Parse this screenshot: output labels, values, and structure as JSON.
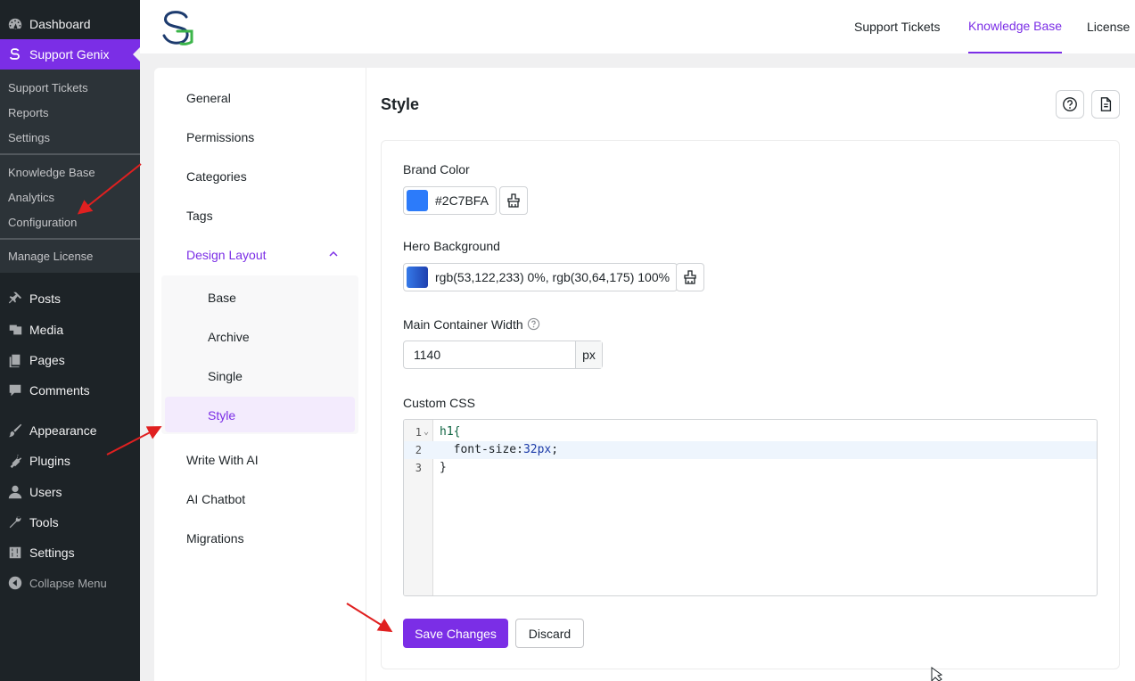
{
  "wp_menu": {
    "dashboard": "Dashboard",
    "support_genix": "Support Genix",
    "submenu_1": [
      "Support Tickets",
      "Reports",
      "Settings"
    ],
    "submenu_2": [
      "Knowledge Base",
      "Analytics",
      "Configuration"
    ],
    "submenu_3": [
      "Manage License"
    ],
    "items": [
      "Posts",
      "Media",
      "Pages",
      "Comments",
      "Appearance",
      "Plugins",
      "Users",
      "Tools",
      "Settings"
    ],
    "collapse": "Collapse Menu"
  },
  "top_tabs": [
    "Support Tickets",
    "Knowledge Base",
    "License"
  ],
  "settings_nav": {
    "items_top": [
      "General",
      "Permissions",
      "Categories",
      "Tags"
    ],
    "design_layout": "Design Layout",
    "design_sub": [
      "Base",
      "Archive",
      "Single",
      "Style"
    ],
    "items_bottom": [
      "Write With AI",
      "AI Chatbot",
      "Migrations"
    ]
  },
  "main": {
    "title": "Style",
    "brand_color_label": "Brand Color",
    "brand_color_value": "#2C7BFA",
    "hero_bg_label": "Hero Background",
    "hero_bg_value": "rgb(53,122,233) 0%, rgb(30,64,175) 100%",
    "width_label": "Main Container Width",
    "width_value": "1140",
    "width_unit": "px",
    "css_label": "Custom CSS",
    "css_lines": [
      "h1{",
      "  font-size:32px;",
      "}"
    ],
    "save": "Save Changes",
    "discard": "Discard"
  },
  "colors": {
    "accent": "#7b2ee6",
    "brand_swatch": "#2C7BFA",
    "hero_from": "#357ae9",
    "hero_to": "#1e40af"
  }
}
